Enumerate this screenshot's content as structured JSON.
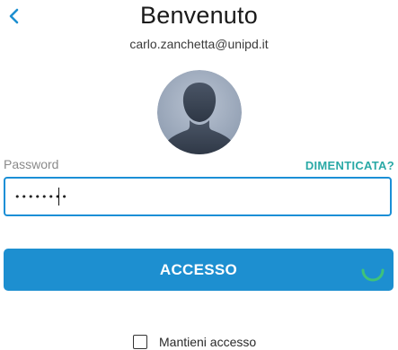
{
  "header": {
    "back_icon": "chevron-left-icon",
    "title": "Benvenuto",
    "email": "carlo.zanchetta@unipd.it"
  },
  "avatar": {
    "icon": "default-user-silhouette"
  },
  "password": {
    "label": "Password",
    "forgot_link": "DIMENTICATA?",
    "value": "••••••••"
  },
  "login": {
    "button_label": "ACCESSO",
    "loading_spinner": "spinner-icon"
  },
  "remember": {
    "label": "Mantieni accesso",
    "checked": false
  },
  "colors": {
    "accent": "#1d8fd0",
    "link": "#2aa9a6",
    "spinner": "#3fc27a"
  }
}
